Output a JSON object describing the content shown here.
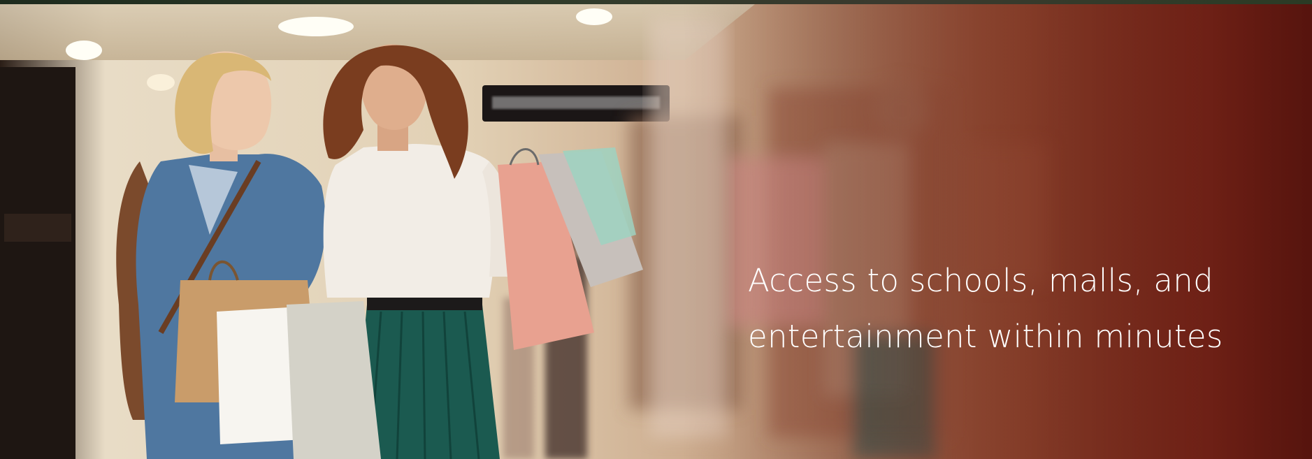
{
  "banner": {
    "caption_lines": [
      "Access to schools, malls, and",
      "entertainment within minutes"
    ]
  },
  "colors": {
    "caption_text": "#ffffff",
    "overlay_dark": "#5a140e",
    "overlay_mid": "#7a2a18"
  },
  "image": {
    "subject": "Two smiling women carrying shopping bags walking through a shopping mall"
  }
}
